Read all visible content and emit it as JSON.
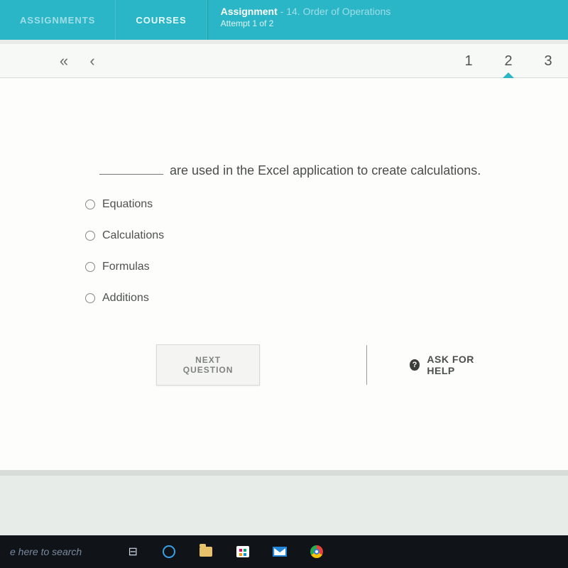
{
  "topbar": {
    "tab_assignments": "ASSIGNMENTS",
    "tab_courses": "COURSES",
    "crumb_label": "Assignment",
    "crumb_sep": " - ",
    "crumb_title": "14. Order of Operations",
    "attempt": "Attempt 1 of 2"
  },
  "nav": {
    "first_glyph": "«",
    "prev_glyph": "‹",
    "pages": [
      "1",
      "2",
      "3"
    ],
    "active_index": 1
  },
  "question": {
    "text": "are used in the Excel application to create calculations.",
    "options": [
      "Equations",
      "Calculations",
      "Formulas",
      "Additions"
    ]
  },
  "actions": {
    "next": "NEXT QUESTION",
    "help": "ASK FOR HELP",
    "help_glyph": "?"
  },
  "taskbar": {
    "search_placeholder": "e here to search"
  }
}
